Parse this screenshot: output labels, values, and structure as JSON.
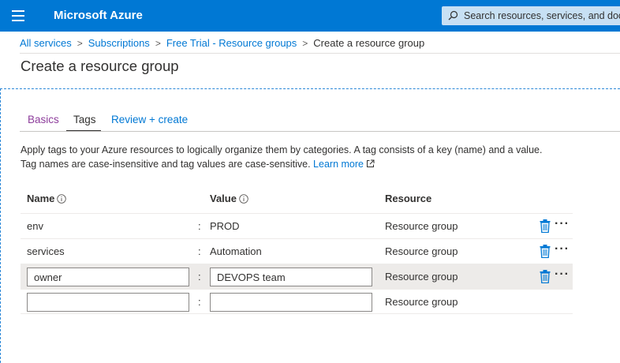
{
  "app": {
    "brand": "Microsoft Azure",
    "search_placeholder": "Search resources, services, and docs (G+/)"
  },
  "breadcrumb": {
    "items": [
      "All services",
      "Subscriptions",
      "Free Trial - Resource groups"
    ],
    "current": "Create a resource group"
  },
  "page": {
    "title": "Create a resource group"
  },
  "tabs": [
    {
      "label": "Basics",
      "state": "visited"
    },
    {
      "label": "Tags",
      "state": "active"
    },
    {
      "label": "Review + create",
      "state": "link"
    }
  ],
  "description": {
    "line1": "Apply tags to your Azure resources to logically organize them by categories. A tag consists of a key (name) and a value.",
    "line2": "Tag names are case-insensitive and tag values are case-sensitive.",
    "learn_more": "Learn more"
  },
  "table": {
    "headers": {
      "name": "Name",
      "value": "Value",
      "resource": "Resource"
    },
    "rows": [
      {
        "name": "env",
        "value": "PROD",
        "resource": "Resource group"
      },
      {
        "name": "services",
        "value": "Automation",
        "resource": "Resource group"
      },
      {
        "name": "owner",
        "value": "DEVOPS team",
        "resource": "Resource group"
      },
      {
        "name": "",
        "value": "",
        "resource": "Resource group"
      }
    ],
    "separator": ":"
  },
  "colors": {
    "accent": "#0078d4",
    "visited": "#8e3e9c",
    "highlight_row": "#edebe9"
  },
  "icons": [
    "hamburger-menu-icon",
    "search-icon",
    "info-icon",
    "external-link-icon",
    "trash-icon",
    "more-icon"
  ]
}
